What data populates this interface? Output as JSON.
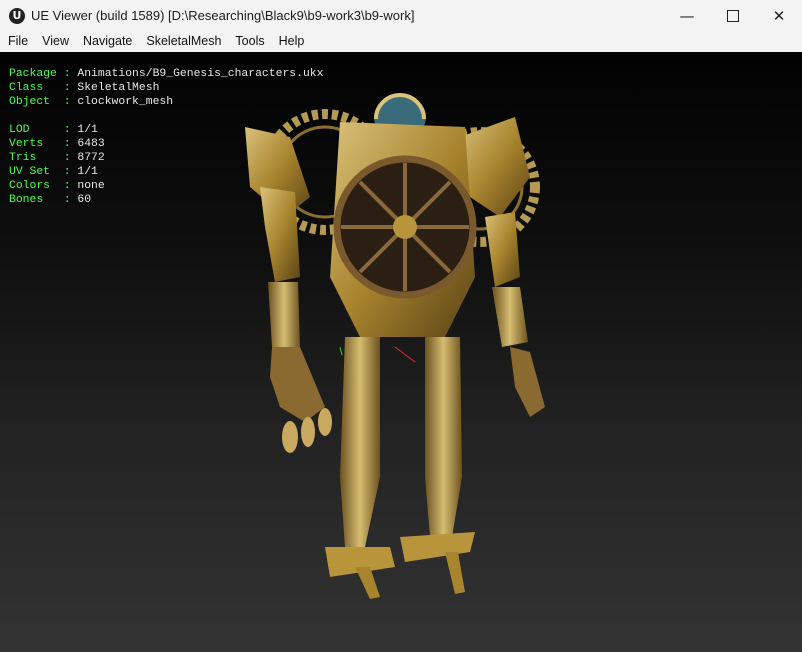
{
  "window": {
    "title": "UE Viewer (build 1589) [D:\\Researching\\Black9\\b9-work3\\b9-work]",
    "app_icon": "unreal-logo-icon",
    "controls": [
      "minimize-icon",
      "maximize-icon",
      "close-icon"
    ]
  },
  "menu": {
    "items": [
      "File",
      "View",
      "Navigate",
      "SkeletalMesh",
      "Tools",
      "Help"
    ]
  },
  "info": {
    "rows": [
      {
        "label": "Package",
        "value": "Animations/B9_Genesis_characters.ukx"
      },
      {
        "label": "Class  ",
        "value": "SkeletalMesh"
      },
      {
        "label": "Object ",
        "value": "clockwork_mesh"
      }
    ],
    "stats": [
      {
        "label": "LOD    ",
        "value": "1/1"
      },
      {
        "label": "Verts  ",
        "value": "6483"
      },
      {
        "label": "Tris   ",
        "value": "8772"
      },
      {
        "label": "UV Set ",
        "value": "1/1"
      },
      {
        "label": "Colors ",
        "value": "none"
      },
      {
        "label": "Bones  ",
        "value": "60"
      }
    ]
  },
  "colors": {
    "label": "#4dff4d",
    "value": "#e8e8e8",
    "brass": "#b8953a"
  }
}
